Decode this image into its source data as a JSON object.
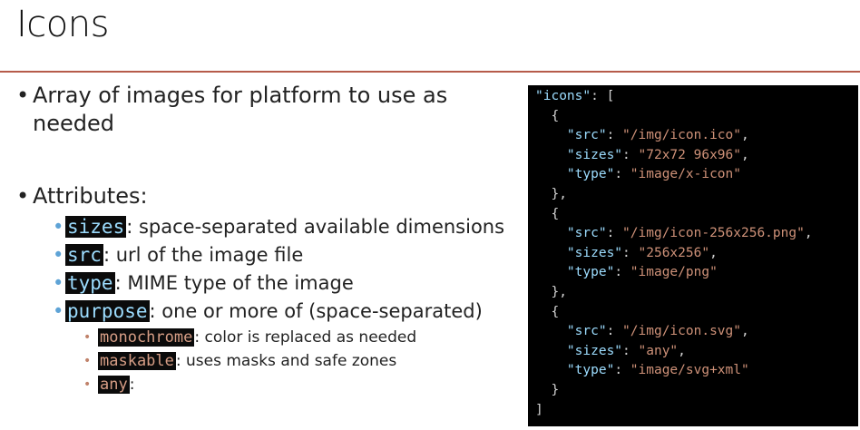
{
  "slide": {
    "title": "Icons",
    "bullet1": "Array of images for platform to use as",
    "bullet1_cont": "needed",
    "bullet2": "Attributes:",
    "attributes": [
      {
        "key": "sizes",
        "desc": ": space-separated available dimensions"
      },
      {
        "key": "src",
        "desc": ": url of the image file"
      },
      {
        "key": "type",
        "desc": ": MIME type of the image"
      },
      {
        "key": "purpose",
        "desc": ": one or more of (space-separated)"
      }
    ],
    "purposes": [
      {
        "key": "monochrome",
        "desc": ": color is replaced as needed"
      },
      {
        "key": "maskable",
        "desc": ": uses masks and safe zones"
      },
      {
        "key": "any",
        "desc": ":"
      }
    ]
  },
  "code": {
    "lines": [
      {
        "indent": "",
        "parts": [
          [
            "k",
            "\"icons\""
          ],
          [
            "p",
            ": ["
          ]
        ]
      },
      {
        "indent": "  ",
        "parts": [
          [
            "p",
            "{"
          ]
        ]
      },
      {
        "indent": "    ",
        "parts": [
          [
            "k",
            "\"src\""
          ],
          [
            "p",
            ": "
          ],
          [
            "s",
            "\"/img/icon.ico\""
          ],
          [
            "p",
            ","
          ]
        ]
      },
      {
        "indent": "    ",
        "parts": [
          [
            "k",
            "\"sizes\""
          ],
          [
            "p",
            ": "
          ],
          [
            "s",
            "\"72x72 96x96\""
          ],
          [
            "p",
            ","
          ]
        ]
      },
      {
        "indent": "    ",
        "parts": [
          [
            "k",
            "\"type\""
          ],
          [
            "p",
            ": "
          ],
          [
            "s",
            "\"image/x-icon\""
          ]
        ]
      },
      {
        "indent": "  ",
        "parts": [
          [
            "p",
            "},"
          ]
        ]
      },
      {
        "indent": "  ",
        "parts": [
          [
            "p",
            "{"
          ]
        ]
      },
      {
        "indent": "    ",
        "parts": [
          [
            "k",
            "\"src\""
          ],
          [
            "p",
            ": "
          ],
          [
            "s",
            "\"/img/icon-256x256.png\""
          ],
          [
            "p",
            ","
          ]
        ]
      },
      {
        "indent": "    ",
        "parts": [
          [
            "k",
            "\"sizes\""
          ],
          [
            "p",
            ": "
          ],
          [
            "s",
            "\"256x256\""
          ],
          [
            "p",
            ","
          ]
        ]
      },
      {
        "indent": "    ",
        "parts": [
          [
            "k",
            "\"type\""
          ],
          [
            "p",
            ": "
          ],
          [
            "s",
            "\"image/png\""
          ]
        ]
      },
      {
        "indent": "  ",
        "parts": [
          [
            "p",
            "},"
          ]
        ]
      },
      {
        "indent": "  ",
        "parts": [
          [
            "p",
            "{"
          ]
        ]
      },
      {
        "indent": "    ",
        "parts": [
          [
            "k",
            "\"src\""
          ],
          [
            "p",
            ": "
          ],
          [
            "s",
            "\"/img/icon.svg\""
          ],
          [
            "p",
            ","
          ]
        ]
      },
      {
        "indent": "    ",
        "parts": [
          [
            "k",
            "\"sizes\""
          ],
          [
            "p",
            ": "
          ],
          [
            "s",
            "\"any\""
          ],
          [
            "p",
            ","
          ]
        ]
      },
      {
        "indent": "    ",
        "parts": [
          [
            "k",
            "\"type\""
          ],
          [
            "p",
            ": "
          ],
          [
            "s",
            "\"image/svg+xml\""
          ]
        ]
      },
      {
        "indent": "  ",
        "parts": [
          [
            "p",
            "}"
          ]
        ]
      },
      {
        "indent": "",
        "parts": [
          [
            "p",
            "]"
          ]
        ]
      }
    ]
  }
}
